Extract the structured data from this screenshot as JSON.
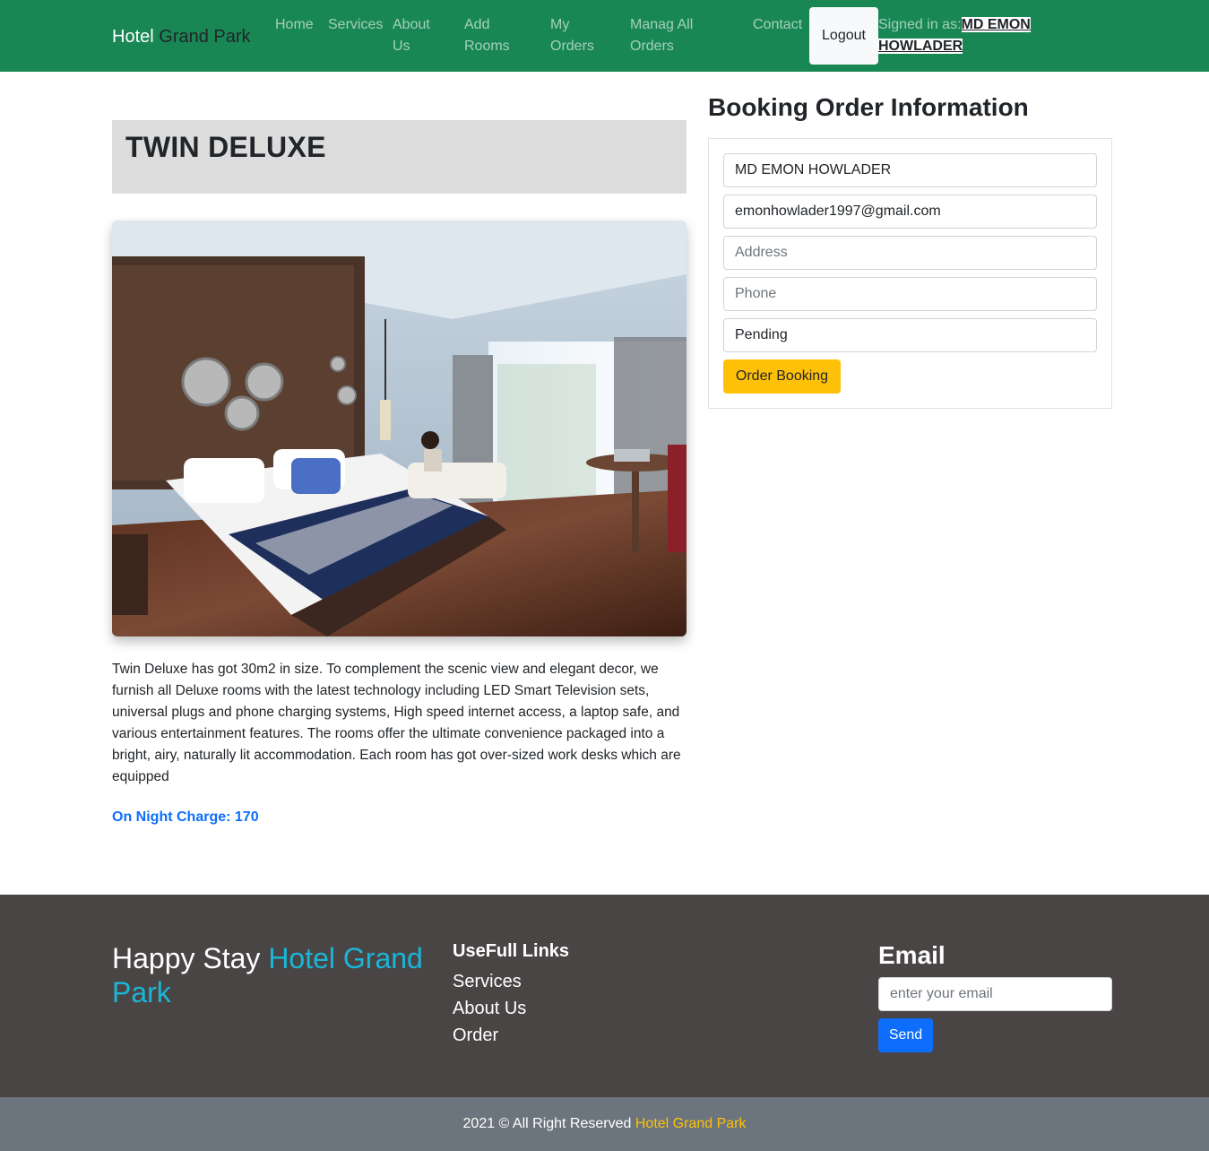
{
  "navbar": {
    "brand_prefix": "Hotel",
    "brand_highlight": "Grand Park",
    "links": {
      "home": "Home",
      "services": "Services",
      "about": "About Us",
      "add_rooms": "Add Rooms",
      "my_orders": "My Orders",
      "manage_orders": "Manag All Orders",
      "contact": "Contact"
    },
    "logout_label": "Logout",
    "signed_in_prefix": "Signed in as:",
    "user_name": "MD EMON HOWLADER",
    "bg_color": "#198754"
  },
  "room": {
    "title": "TWIN DELUXE",
    "description": "Twin Deluxe has got 30m2 in size. To complement the scenic view and elegant decor, we furnish all Deluxe rooms with the latest technology including LED Smart Television sets, universal plugs and phone charging systems, High speed internet access, a laptop safe, and various entertainment features. The rooms offer the ultimate convenience packaged into a bright, airy, naturally lit accommodation. Each room has got over-sized work desks which are equipped",
    "night_charge_label": "On Night Charge:",
    "night_charge_value": "170"
  },
  "booking": {
    "heading": "Booking Order Information",
    "name_value": "MD EMON HOWLADER",
    "email_value": "emonhowlader1997@gmail.com",
    "address_placeholder": "Address",
    "phone_placeholder": "Phone",
    "status_value": "Pending",
    "submit_label": "Order Booking"
  },
  "footer": {
    "tagline_prefix": "Happy Stay",
    "tagline_highlight": "Hotel Grand Park",
    "links_heading": "UseFull Links",
    "links": [
      "Services",
      "About Us",
      "Order"
    ],
    "email_heading": "Email",
    "email_placeholder": "enter your email",
    "send_label": "Send",
    "copyright_prefix": "2021 © All Right Reserved",
    "copyright_highlight": "Hotel Grand Park",
    "bg_color": "#4a4545"
  }
}
